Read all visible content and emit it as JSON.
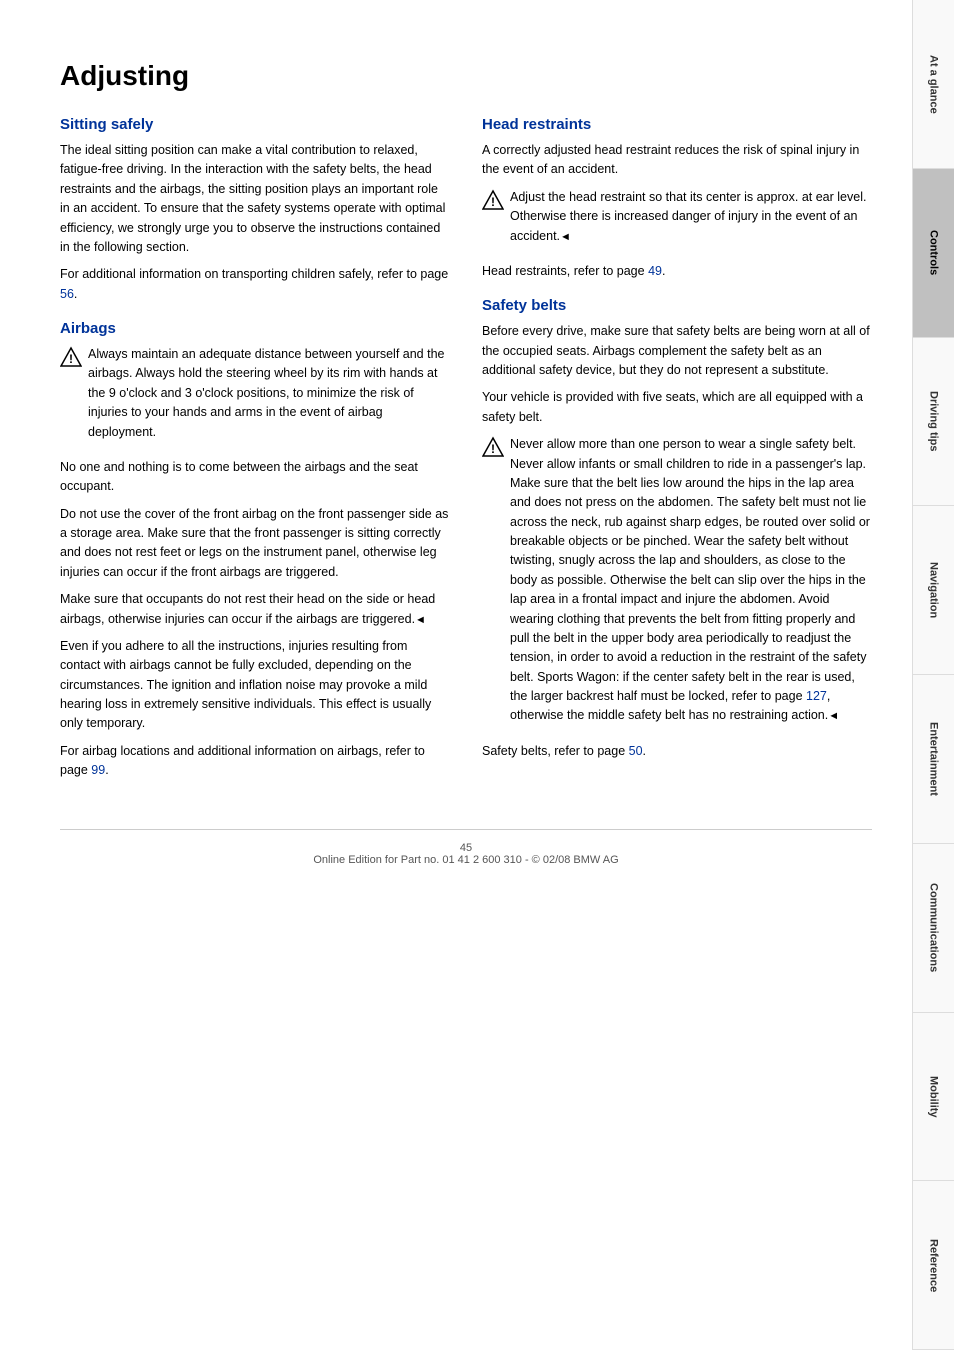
{
  "page": {
    "title": "Adjusting",
    "page_number": "45",
    "footer_text": "Online Edition for Part no. 01 41 2 600 310 - © 02/08 BMW AG"
  },
  "sidebar": {
    "sections": [
      {
        "label": "At a glance",
        "active": false
      },
      {
        "label": "Controls",
        "active": true
      },
      {
        "label": "Driving tips",
        "active": false
      },
      {
        "label": "Navigation",
        "active": false
      },
      {
        "label": "Entertainment",
        "active": false
      },
      {
        "label": "Communications",
        "active": false
      },
      {
        "label": "Mobility",
        "active": false
      },
      {
        "label": "Reference",
        "active": false
      }
    ]
  },
  "left_column": {
    "sitting_safely_heading": "Sitting safely",
    "sitting_safely_text": "The ideal sitting position can make a vital contribution to relaxed, fatigue-free driving. In the interaction with the safety belts, the head restraints and the airbags, the sitting position plays an important role in an accident. To ensure that the safety systems operate with optimal efficiency, we strongly urge you to observe the instructions contained in the following section.",
    "children_ref": "For additional information on transporting children safely, refer to page ",
    "children_page": "56",
    "airbags_heading": "Airbags",
    "airbag_warning": "Always maintain an adequate distance between yourself and the airbags. Always hold the steering wheel by its rim with hands at the 9 o'clock and 3 o'clock positions, to minimize the risk of injuries to your hands and arms in the event of airbag deployment.",
    "airbag_p1": "No one and nothing is to come between the airbags and the seat occupant.",
    "airbag_p2": "Do not use the cover of the front airbag on the front passenger side as a storage area. Make sure that the front passenger is sitting correctly and does not rest feet or legs on the instrument panel, otherwise leg injuries can occur if the front airbags are triggered.",
    "airbag_p3": "Make sure that occupants do not rest their head on the side or head airbags, otherwise injuries can occur if the airbags are triggered.",
    "airbag_p3_symbol": "◄",
    "airbag_p4": "Even if you adhere to all the instructions, injuries resulting from contact with airbags cannot be fully excluded, depending on the circumstances. The ignition and inflation noise may provoke a mild hearing loss in extremely sensitive individuals. This effect is usually only temporary.",
    "airbag_ref_text": "For airbag locations and additional information on airbags, refer to page ",
    "airbag_ref_page": "99"
  },
  "right_column": {
    "head_restraints_heading": "Head restraints",
    "head_restraints_intro": "A correctly adjusted head restraint reduces the risk of spinal injury in the event of an accident.",
    "head_restraints_warning": "Adjust the head restraint so that its center is approx. at ear level. Otherwise there is increased danger of injury in the event of an accident.",
    "head_restraints_symbol": "◄",
    "head_restraints_ref_text": "Head restraints, refer to page ",
    "head_restraints_ref_page": "49",
    "safety_belts_heading": "Safety belts",
    "safety_belts_p1": "Before every drive, make sure that safety belts are being worn at all of the occupied seats. Airbags complement the safety belt as an additional safety device, but they do not represent a substitute.",
    "safety_belts_p2": "Your vehicle is provided with five seats, which are all equipped with a safety belt.",
    "safety_belts_warning": "Never allow more than one person to wear a single safety belt. Never allow infants or small children to ride in a passenger's lap. Make sure that the belt lies low around the hips in the lap area and does not press on the abdomen. The safety belt must not lie across the neck, rub against sharp edges, be routed over solid or breakable objects or be pinched. Wear the safety belt without twisting, snugly across the lap and shoulders, as close to the body as possible. Otherwise the belt can slip over the hips in the lap area in a frontal impact and injure the abdomen. Avoid wearing clothing that prevents the belt from fitting properly and pull the belt in the upper body area periodically to readjust the tension, in order to avoid a reduction in the restraint of the safety belt. Sports Wagon: if the center safety belt in the rear is used, the larger backrest half must be locked, refer to page ",
    "safety_belts_warning_page": "127",
    "safety_belts_warning_end": ", otherwise the middle safety belt has no restraining action.",
    "safety_belts_warning_symbol": "◄",
    "safety_belts_ref_text": "Safety belts, refer to page ",
    "safety_belts_ref_page": "50"
  }
}
